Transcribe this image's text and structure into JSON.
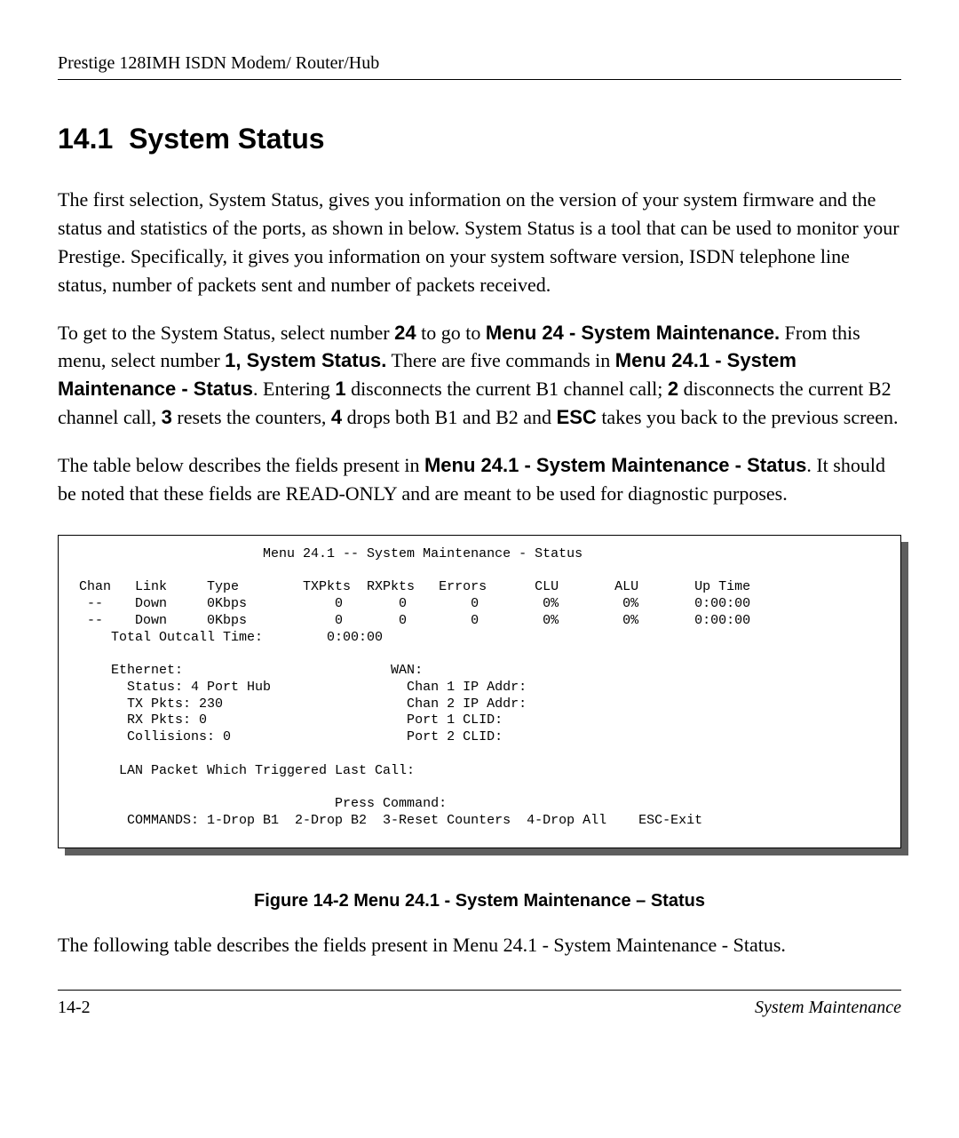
{
  "header": {
    "running_head": "Prestige 128IMH ISDN Modem/ Router/Hub"
  },
  "section": {
    "number": "14.1",
    "title": "System Status"
  },
  "paragraphs": {
    "p1": "The first selection, System Status, gives you information on the version of your system firmware and the status and statistics of the ports, as shown in  below. System Status is a tool that can be used to monitor your Prestige. Specifically, it gives you information on your system software version, ISDN telephone line status, number of packets sent and number of packets received.",
    "p2a": "To get to the System Status, select number ",
    "p2b": "24",
    "p2c": " to go to ",
    "p2d": "Menu 24 - System Maintenance.",
    "p2e": " From this menu, select number ",
    "p2f": "1, System Status.",
    "p2g": " There are five commands in ",
    "p2h": "Menu 24.1 - System Maintenance - Status",
    "p2i": ". Entering ",
    "p2j": "1",
    "p2k": " disconnects the current B1 channel call; ",
    "p2l": "2",
    "p2m": " disconnects the current B2 channel call, ",
    "p2n": "3",
    "p2o": " resets the counters, ",
    "p2p": "4",
    "p2q": " drops both B1 and B2 and ",
    "p2r": "ESC",
    "p2s": " takes you back to the previous screen.",
    "p3a": "The table below describes the fields present in ",
    "p3b": "Menu 24.1 - System Maintenance - Status",
    "p3c": ". It should be noted that these fields are READ-ONLY and are meant to be used for diagnostic purposes.",
    "p4": "The following table describes the fields present in Menu 24.1 - System Maintenance - Status."
  },
  "terminal": {
    "title": "                        Menu 24.1 -- System Maintenance - Status",
    "hdr": " Chan   Link     Type        TXPkts  RXPkts   Errors      CLU       ALU       Up Time",
    "row1": "  --    Down     0Kbps           0       0        0        0%        0%       0:00:00",
    "row2": "  --    Down     0Kbps           0       0        0        0%        0%       0:00:00",
    "outcall": "     Total Outcall Time:        0:00:00",
    "ethwan": "     Ethernet:                          WAN:",
    "status": "       Status: 4 Port Hub                 Chan 1 IP Addr:",
    "txpkts": "       TX Pkts: 230                       Chan 2 IP Addr:",
    "rxpkts": "       RX Pkts: 0                         Port 1 CLID:",
    "coll": "       Collisions: 0                      Port 2 CLID:",
    "lantrig": "      LAN Packet Which Triggered Last Call:",
    "press": "                                 Press Command:",
    "commands": "       COMMANDS: 1-Drop B1  2-Drop B2  3-Reset Counters  4-Drop All    ESC-Exit"
  },
  "figure": {
    "caption": "Figure 14-2 Menu 24.1 - System Maintenance – Status"
  },
  "footer": {
    "page_num": "14-2",
    "section": "System Maintenance"
  }
}
